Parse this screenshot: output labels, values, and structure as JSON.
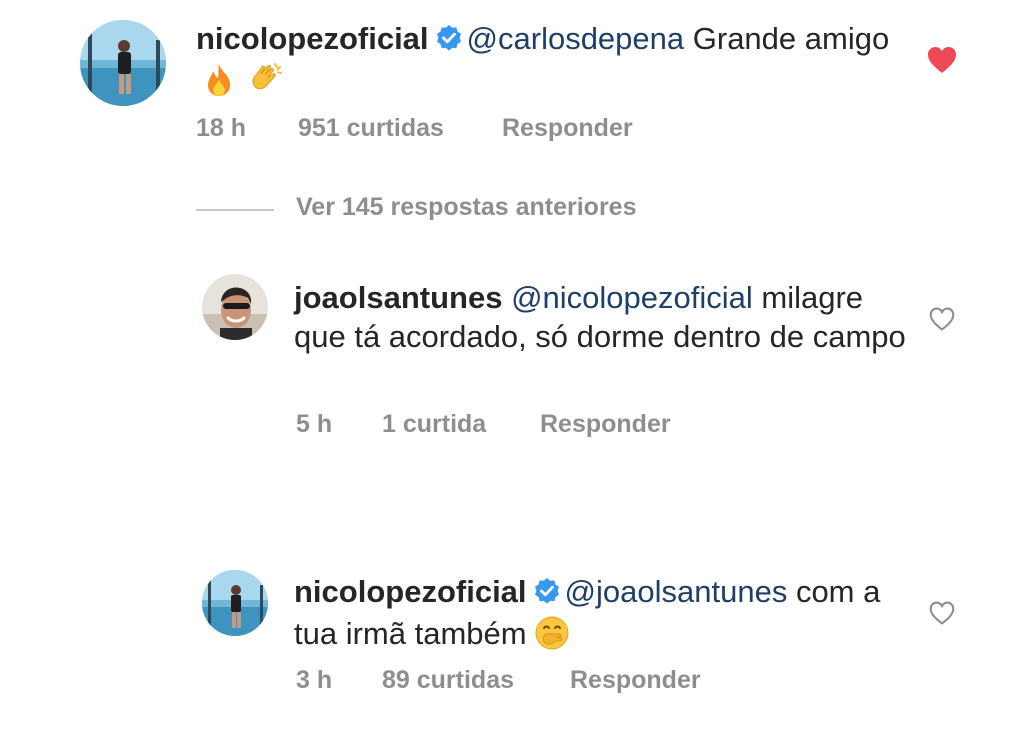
{
  "comments": [
    {
      "username": "nicolopezoficial",
      "verified": true,
      "mention": "@carlosdepena",
      "text": " Grande amigo",
      "emojis": [
        "fire-emoji",
        "clapping-hands-emoji"
      ],
      "time": "18 h",
      "likes": "951 curtidas",
      "reply": "Responder",
      "liked": true
    },
    {
      "username": "joaolsantunes",
      "verified": false,
      "mention": "@nicolopezoficial",
      "text": " milagre que tá acordado, só dorme dentro de campo",
      "time": "5 h",
      "likes": "1 curtida",
      "reply": "Responder",
      "liked": false
    },
    {
      "username": "nicolopezoficial",
      "verified": true,
      "mention": "@joaolsantunes",
      "text": " com a tua irmã também",
      "emojis": [
        "hand-over-mouth-emoji"
      ],
      "time": "3 h",
      "likes": "89 curtidas",
      "reply": "Responder",
      "liked": false
    }
  ],
  "view_replies": "Ver 145 respostas anteriores",
  "colors": {
    "heart_liked": "#ed4956",
    "mention": "#1f3f6b",
    "meta": "#8e8e8e",
    "verified": "#3897f0"
  }
}
